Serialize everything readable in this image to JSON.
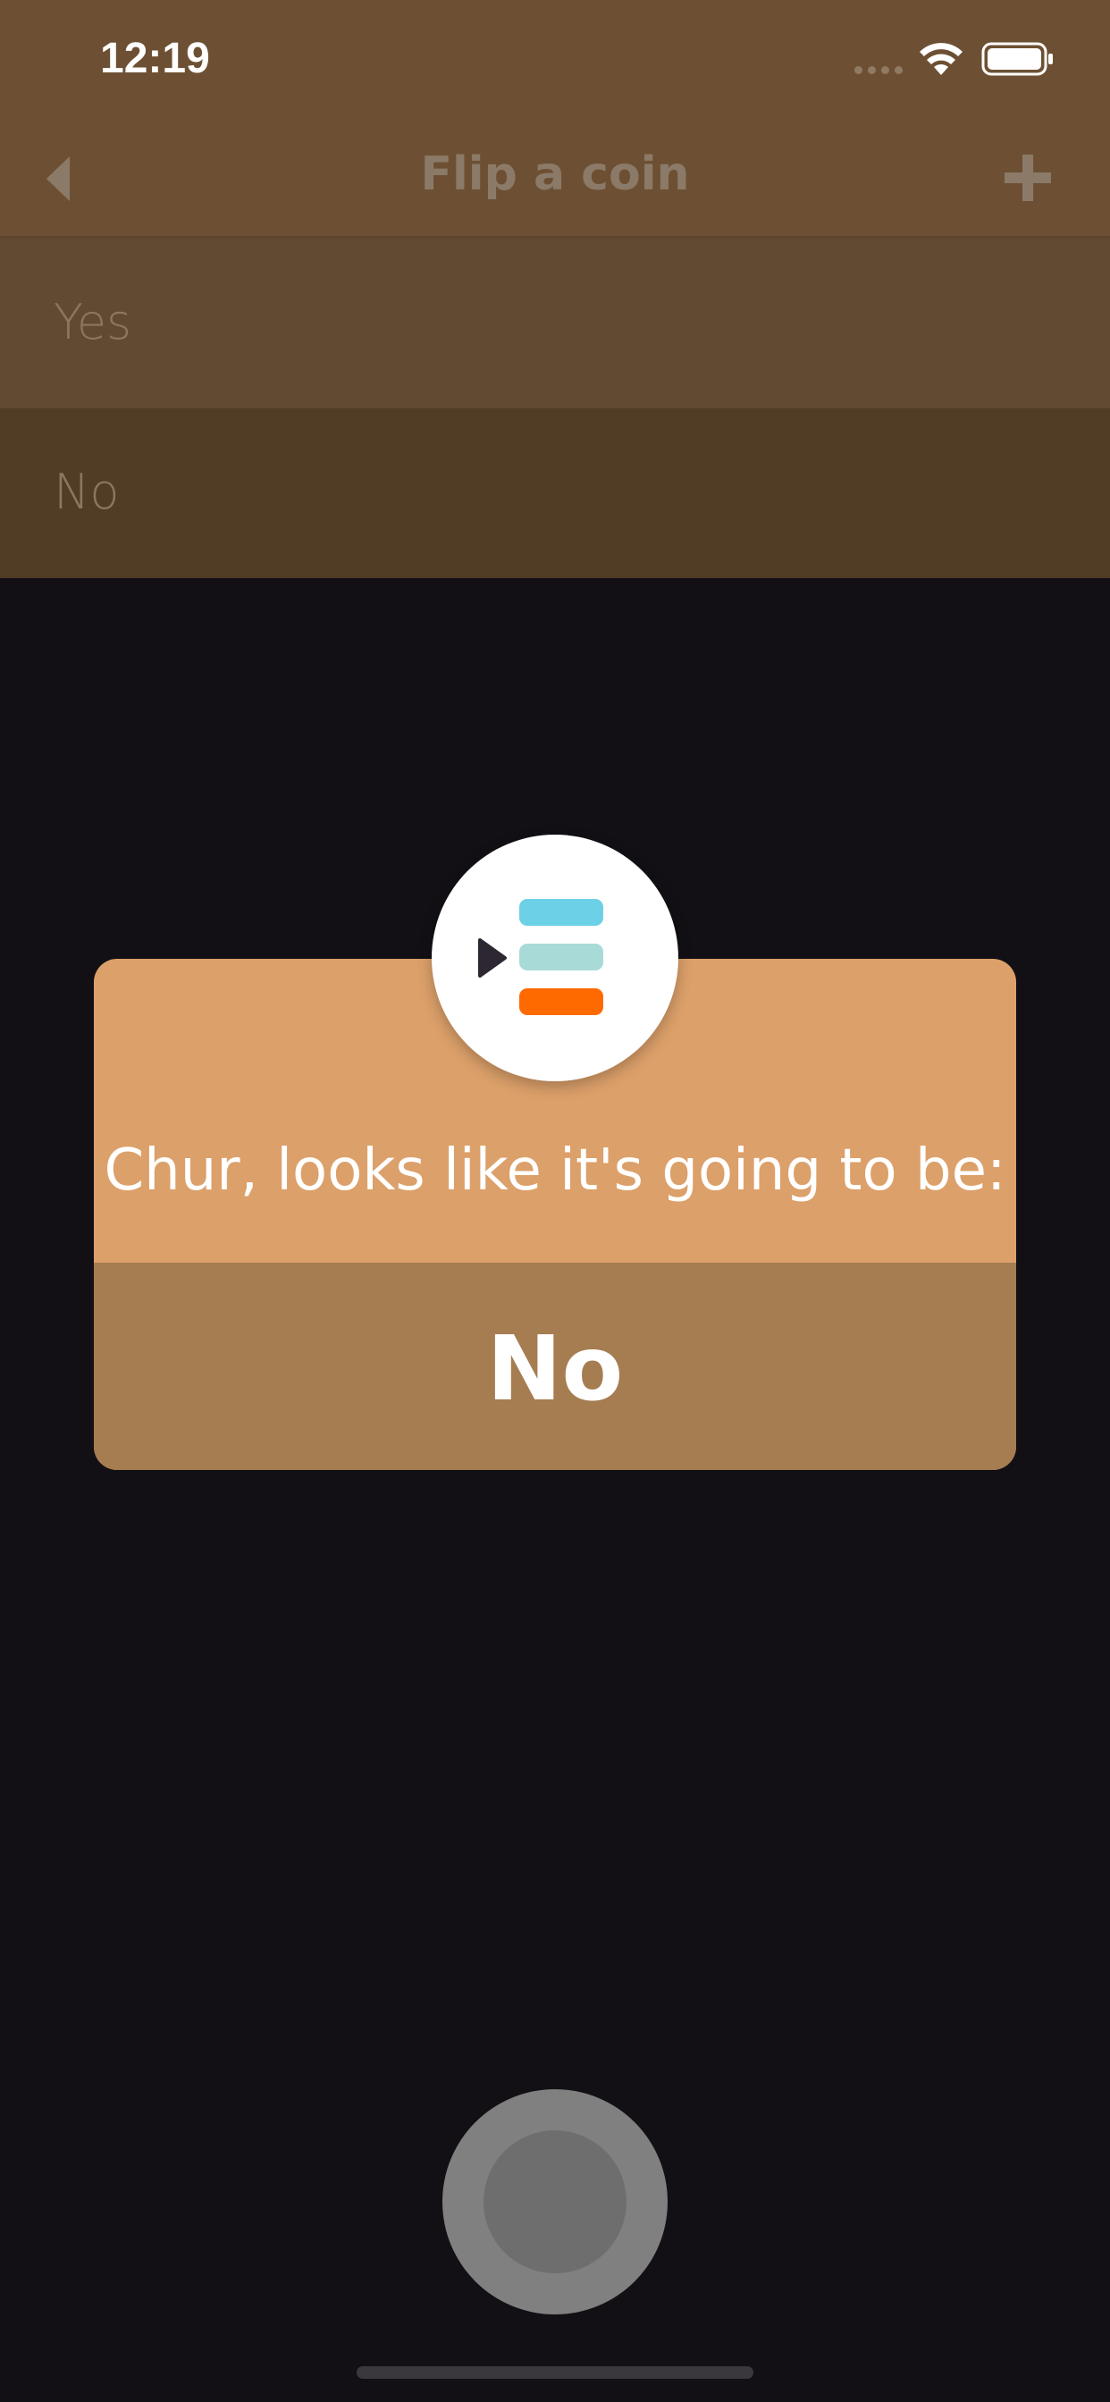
{
  "status_bar": {
    "time": "12:19",
    "icons": [
      "signal-dots-icon",
      "wifi-icon",
      "battery-icon"
    ]
  },
  "nav": {
    "title": "Flip a coin",
    "back_icon": "chevron-left-icon",
    "add_icon": "plus-icon"
  },
  "options": [
    {
      "label": "Yes"
    },
    {
      "label": "No"
    }
  ],
  "modal": {
    "logo_icon": "app-logo-icon",
    "message": "Chur, looks like it's going to be:",
    "result": "No"
  },
  "flip_button": {
    "icon": "flip-button-icon"
  },
  "colors": {
    "header": "#6d5033",
    "modal_top": "#dca06a",
    "modal_bottom": "#a67c51",
    "background": "#121014",
    "logo_blue": "#6cd0e6",
    "logo_teal": "#a8dbd7",
    "logo_orange": "#ff6a00"
  }
}
